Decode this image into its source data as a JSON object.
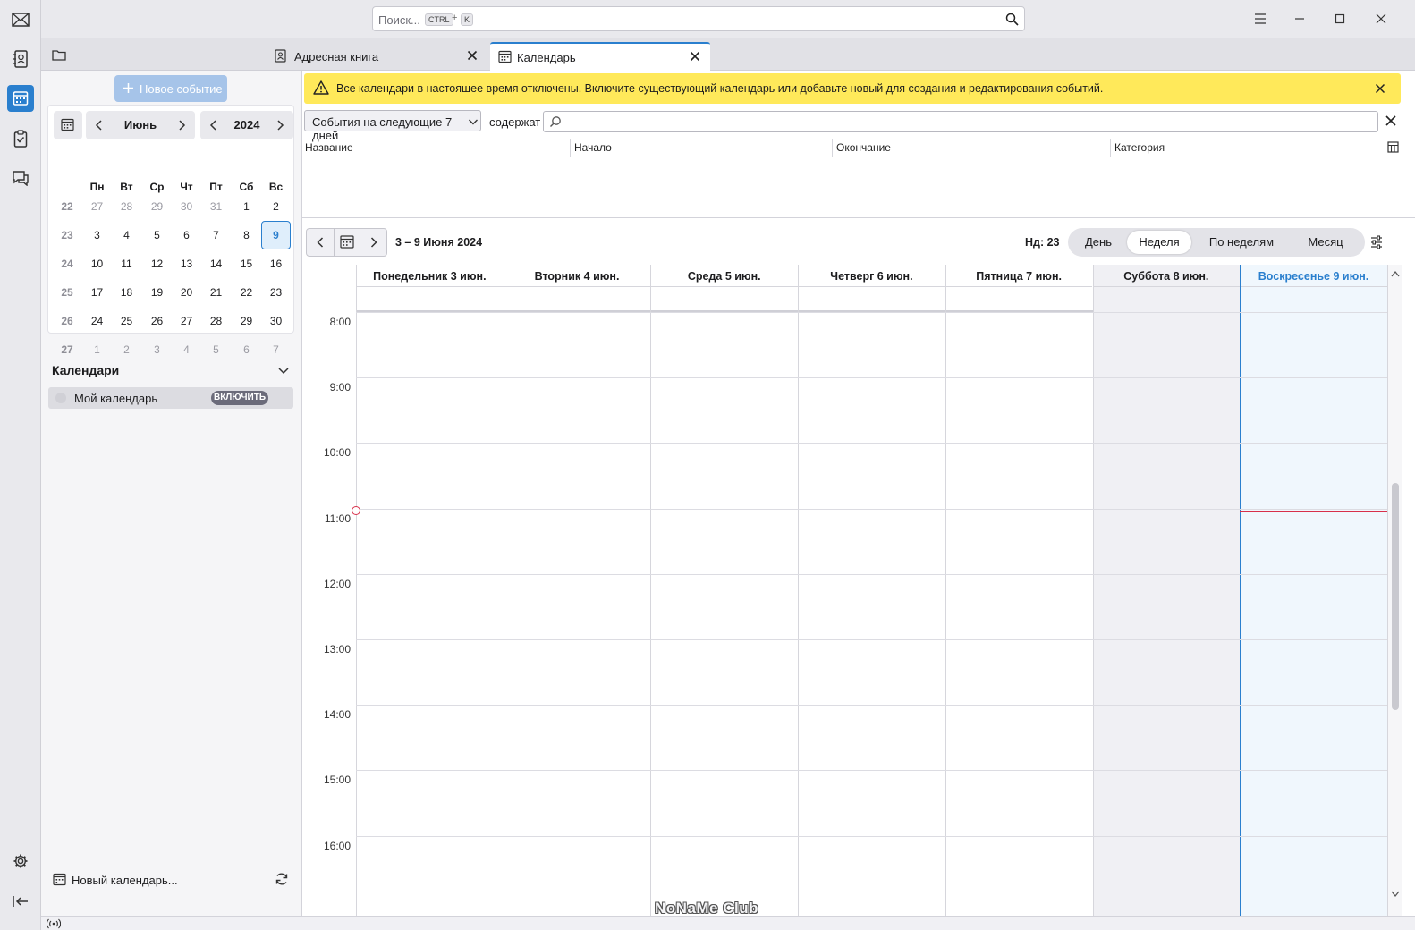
{
  "titlebar": {
    "search_placeholder": "Поиск...",
    "kbd_ctrl": "CTRL",
    "kbd_plus": "+",
    "kbd_k": "K"
  },
  "tabs": [
    {
      "label": "Адресная книга"
    },
    {
      "label": "Календарь"
    }
  ],
  "sidebar": {
    "new_event": "Новое событие",
    "minimonth": {
      "month": "Июнь",
      "year": "2024",
      "weekdays": [
        "Пн",
        "Вт",
        "Ср",
        "Чт",
        "Пт",
        "Сб",
        "Вс"
      ],
      "weeks": [
        {
          "num": "22",
          "days": [
            "27",
            "28",
            "29",
            "30",
            "31",
            "1",
            "2"
          ]
        },
        {
          "num": "23",
          "days": [
            "3",
            "4",
            "5",
            "6",
            "7",
            "8",
            "9"
          ]
        },
        {
          "num": "24",
          "days": [
            "10",
            "11",
            "12",
            "13",
            "14",
            "15",
            "16"
          ]
        },
        {
          "num": "25",
          "days": [
            "17",
            "18",
            "19",
            "20",
            "21",
            "22",
            "23"
          ]
        },
        {
          "num": "26",
          "days": [
            "24",
            "25",
            "26",
            "27",
            "28",
            "29",
            "30"
          ]
        },
        {
          "num": "27",
          "days": [
            "1",
            "2",
            "3",
            "4",
            "5",
            "6",
            "7"
          ]
        }
      ],
      "selected_day": "9"
    },
    "calendars_header": "Календари",
    "calendar_name": "Мой календарь",
    "enable_label": "ВКЛЮЧИТЬ",
    "new_calendar": "Новый календарь..."
  },
  "notification": {
    "text": "Все календари в настоящее время отключены. Включите существующий календарь или добавьте новый для создания и редактирования событий."
  },
  "filter": {
    "select_value": "События на следующие 7 дней",
    "contains_label": "содержат"
  },
  "unifinder": {
    "columns": [
      "Название",
      "Начало",
      "Окончание",
      "Категория"
    ]
  },
  "calendar_nav": {
    "range": "3 – 9 Июня 2024",
    "week_label": "Нд: 23",
    "views": [
      "День",
      "Неделя",
      "По неделям",
      "Месяц"
    ],
    "active_view": "Неделя"
  },
  "week": {
    "days": [
      "Понедельник 3 июн.",
      "Вторник 4 июн.",
      "Среда 5 июн.",
      "Четверг 6 июн.",
      "Пятница 7 июн.",
      "Суббота 8 июн.",
      "Воскресенье 9 июн."
    ],
    "hours": [
      "8:00",
      "9:00",
      "10:00",
      "11:00",
      "12:00",
      "13:00",
      "14:00",
      "15:00",
      "16:00"
    ],
    "current_time_hours": 11.03,
    "today_index": 6,
    "colors": {
      "accent": "#2a7fce",
      "weekend_bg": "#f0f0f4",
      "today_bg": "#f0f7fd",
      "now_line": "#d8304a"
    }
  },
  "watermark": "NoNaMe Club"
}
